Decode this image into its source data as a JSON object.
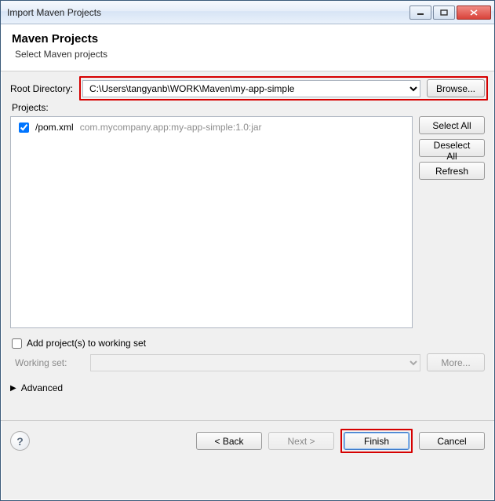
{
  "window": {
    "title": "Import Maven Projects"
  },
  "header": {
    "heading": "Maven Projects",
    "subtitle": "Select Maven projects"
  },
  "dir": {
    "label": "Root Directory:",
    "value": "C:\\Users\\tangyanb\\WORK\\Maven\\my-app-simple",
    "browse": "Browse..."
  },
  "projects": {
    "label": "Projects:",
    "items": [
      {
        "checked": true,
        "path": "/pom.xml",
        "gav": "com.mycompany.app:my-app-simple:1.0:jar"
      }
    ],
    "selectAll": "Select All",
    "deselectAll": "Deselect All",
    "refresh": "Refresh"
  },
  "workingSet": {
    "addLabel": "Add project(s) to working set",
    "addChecked": false,
    "label": "Working set:",
    "value": "",
    "more": "More..."
  },
  "advanced": {
    "label": "Advanced"
  },
  "footer": {
    "back": "< Back",
    "next": "Next >",
    "finish": "Finish",
    "cancel": "Cancel"
  }
}
